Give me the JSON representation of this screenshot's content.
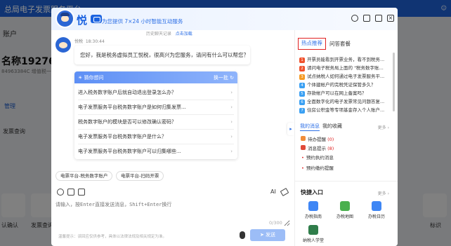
{
  "background_page": {
    "title": "总局电子发票服务平台",
    "account_label": "账户",
    "company_name": "名称1927680",
    "tax_no": "84963384C 增值税一般",
    "manage_link": "管理",
    "invoice_query": "发票查询",
    "confirm_label": "认确认",
    "invoice_query2": "发票查询",
    "right_label": "标识"
  },
  "header": {
    "logo_text": "悦",
    "slogan": "为您提供 7×24 小时智能互动服务",
    "icons": [
      "user-icon",
      "expand-icon",
      "minimize-icon",
      "close-icon"
    ]
  },
  "chat": {
    "history_label": "历史聊天记录",
    "history_link": "点击加载",
    "bot_name": "悦税",
    "time": "18:30:44",
    "greeting": "您好，我是税务虚拟员工悦税，很高兴为您服务，请问有什么可以帮您？",
    "guess_title": "猜你想问",
    "refresh_label": "换一批",
    "questions": [
      "进入税务数字账户后就自动退出登录怎么办？",
      "电子发票服务平台税务数字账户是如何归集发票...",
      "税务数字账户的模块是否可以修改确认密码？",
      "电子发票服务平台税务数字账户是什么？",
      "电子发票服务平台税务数字账户可以归集哪些..."
    ],
    "chips": [
      "电票平台-税务数字账户",
      "电票平台-扫码开票"
    ]
  },
  "composer": {
    "ai_label": "AI",
    "placeholder": "请输入，按Enter直接发送消息，Shift+Enter换行",
    "counter": "0/300",
    "tip": "温馨提示：该回应仅供参考，具体以法律法规及相关规定为准。",
    "send_label": "发送"
  },
  "sidebar": {
    "tab_hot": "热点推荐",
    "tab_faq": "问答套餐",
    "hot_list": [
      "开票员能看到开票业务，看不到税务...",
      "请问电子税务局上面的 \"税务数字账...",
      "试点纳税人如何通过电子发票服务平...",
      "个体建帐户的完税凭证保管多久？",
      "存款帐户可以在网上备案吗？",
      "全面数字化的电子发票常见问题答复...",
      "住房公积金等专项基金存入个人账户..."
    ],
    "rank_colors": [
      "#f0522d",
      "#f0522d",
      "#f59a23",
      "#3aa0f3",
      "#3aa0f3",
      "#3aa0f3",
      "#3aa0f3"
    ],
    "msg_tab": "我的消息",
    "fav_tab": "我的收藏",
    "more_label": "更多",
    "messages": [
      {
        "label": "待办提醒",
        "count": "(0)",
        "color": "#f08c3a"
      },
      {
        "label": "消息提示",
        "count": "(8)",
        "color": "#e04a3a"
      }
    ],
    "bullets": [
      "预约执约消息",
      "预约缴约提醒"
    ],
    "quick_title": "快捷入口",
    "quick_more": "更多",
    "quick_tiles": [
      {
        "label": "办税指南",
        "color": "#3e86f5"
      },
      {
        "label": "办税地图",
        "color": "#4ab04e"
      },
      {
        "label": "办税日历",
        "color": "#3e86f5"
      },
      {
        "label": "纳税人学堂",
        "color": "#2f7d4a"
      }
    ]
  }
}
